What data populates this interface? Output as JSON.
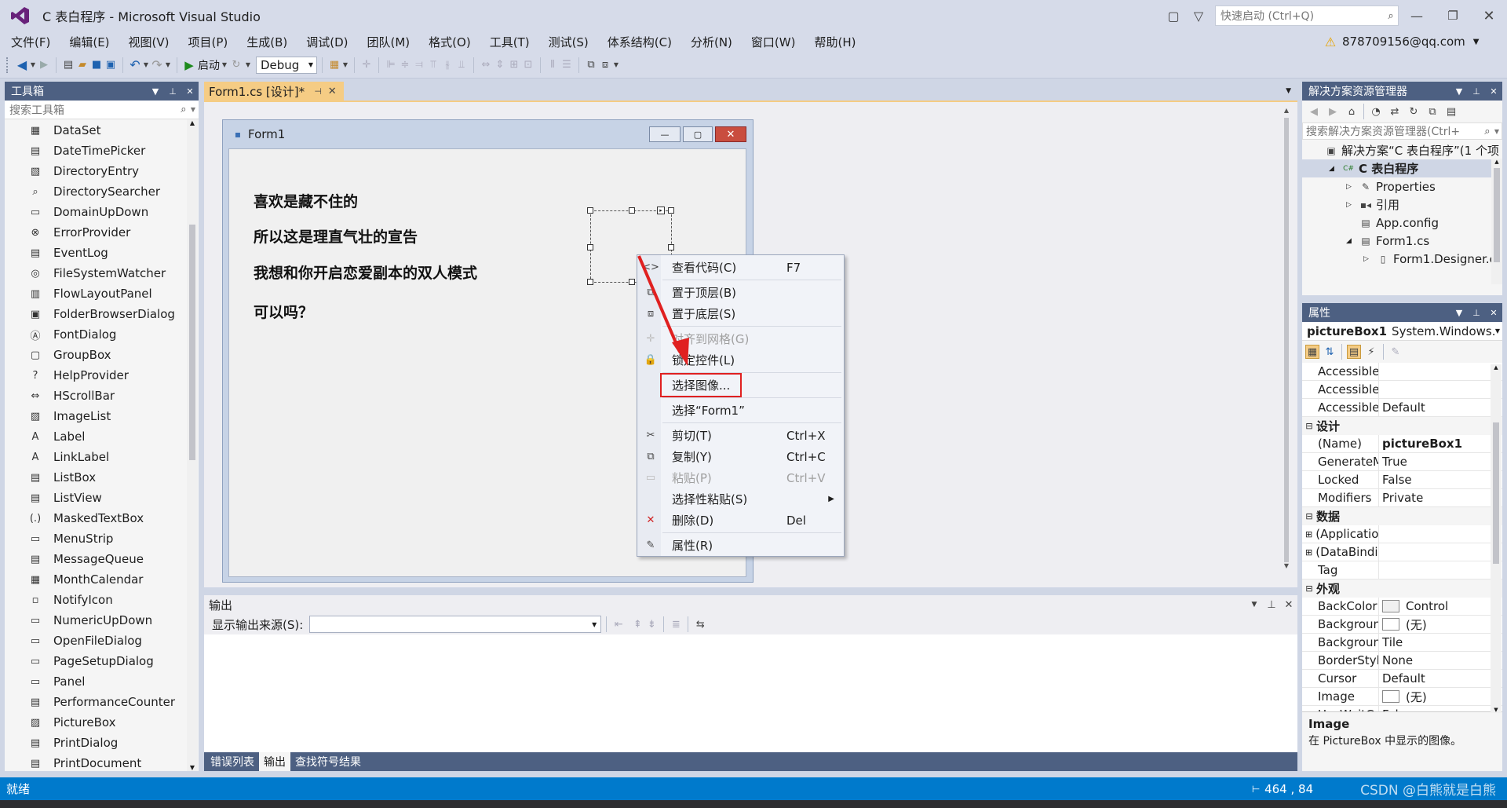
{
  "window": {
    "title": "C 表白程序 - Microsoft Visual Studio",
    "quick_launch_placeholder": "快速启动 (Ctrl+Q)",
    "account": "878709156@qq.com"
  },
  "menu": [
    "文件(F)",
    "编辑(E)",
    "视图(V)",
    "项目(P)",
    "生成(B)",
    "调试(D)",
    "团队(M)",
    "格式(O)",
    "工具(T)",
    "测试(S)",
    "体系结构(C)",
    "分析(N)",
    "窗口(W)",
    "帮助(H)"
  ],
  "toolbar": {
    "start_label": "启动",
    "config_value": "Debug"
  },
  "toolbox": {
    "title": "工具箱",
    "search_placeholder": "搜索工具箱",
    "items": [
      "DataSet",
      "DateTimePicker",
      "DirectoryEntry",
      "DirectorySearcher",
      "DomainUpDown",
      "ErrorProvider",
      "EventLog",
      "FileSystemWatcher",
      "FlowLayoutPanel",
      "FolderBrowserDialog",
      "FontDialog",
      "GroupBox",
      "HelpProvider",
      "HScrollBar",
      "ImageList",
      "Label",
      "LinkLabel",
      "ListBox",
      "ListView",
      "MaskedTextBox",
      "MenuStrip",
      "MessageQueue",
      "MonthCalendar",
      "NotifyIcon",
      "NumericUpDown",
      "OpenFileDialog",
      "PageSetupDialog",
      "Panel",
      "PerformanceCounter",
      "PictureBox",
      "PrintDialog",
      "PrintDocument"
    ]
  },
  "doc_tab": {
    "label": "Form1.cs [设计]*"
  },
  "form": {
    "title": "Form1",
    "lines": [
      "喜欢是藏不住的",
      "所以这是理直气壮的宣告",
      "我想和你开启恋爱副本的双人模式",
      "可以吗？"
    ]
  },
  "context_menu": {
    "items": [
      {
        "label": "查看代码(C)",
        "shortcut": "F7",
        "icon": "code-icon",
        "disabled": false
      },
      {
        "sep": true
      },
      {
        "label": "置于顶层(B)",
        "shortcut": "",
        "icon": "bring-to-front-icon",
        "disabled": false
      },
      {
        "label": "置于底层(S)",
        "shortcut": "",
        "icon": "send-to-back-icon",
        "disabled": false
      },
      {
        "sep": true
      },
      {
        "label": "对齐到网格(G)",
        "shortcut": "",
        "icon": "align-grid-icon",
        "disabled": true
      },
      {
        "label": "锁定控件(L)",
        "shortcut": "",
        "icon": "lock-icon",
        "disabled": false
      },
      {
        "sep": true
      },
      {
        "label": "选择图像...",
        "shortcut": "",
        "icon": "",
        "disabled": false,
        "highlighted": true
      },
      {
        "sep": true
      },
      {
        "label": "选择“Form1”",
        "shortcut": "",
        "icon": "",
        "disabled": false
      },
      {
        "sep": true
      },
      {
        "label": "剪切(T)",
        "shortcut": "Ctrl+X",
        "icon": "cut-icon",
        "disabled": false
      },
      {
        "label": "复制(Y)",
        "shortcut": "Ctrl+C",
        "icon": "copy-icon",
        "disabled": false
      },
      {
        "label": "粘贴(P)",
        "shortcut": "Ctrl+V",
        "icon": "paste-icon",
        "disabled": true
      },
      {
        "label": "选择性粘贴(S)",
        "shortcut": "",
        "icon": "",
        "disabled": false,
        "submenu": true
      },
      {
        "label": "删除(D)",
        "shortcut": "Del",
        "icon": "delete-icon",
        "disabled": false
      },
      {
        "sep": true
      },
      {
        "label": "属性(R)",
        "shortcut": "",
        "icon": "wrench-icon",
        "disabled": false
      }
    ]
  },
  "output": {
    "title": "输出",
    "source_label": "显示输出来源(S):"
  },
  "bottom_tabs": [
    "错误列表",
    "输出",
    "查找符号结果"
  ],
  "solution_explorer": {
    "title": "解决方案资源管理器",
    "search_placeholder": "搜索解决方案资源管理器(Ctrl+",
    "nodes": [
      {
        "label": "解决方案“C 表白程序”(1 个项",
        "level": 0,
        "arrow": "",
        "icon": "solution-icon",
        "bold": false
      },
      {
        "label": "C 表白程序",
        "level": 1,
        "arrow": "◢",
        "icon": "csharp-project-icon",
        "bold": true
      },
      {
        "label": "Properties",
        "level": 2,
        "arrow": "▷",
        "icon": "wrench-icon",
        "bold": false
      },
      {
        "label": "引用",
        "level": 2,
        "arrow": "▷",
        "icon": "references-icon",
        "bold": false
      },
      {
        "label": "App.config",
        "level": 2,
        "arrow": "",
        "icon": "config-file-icon",
        "bold": false
      },
      {
        "label": "Form1.cs",
        "level": 2,
        "arrow": "◢",
        "icon": "form-icon",
        "bold": false
      },
      {
        "label": "Form1.Designer.c",
        "level": 3,
        "arrow": "▷",
        "icon": "cs-file-icon",
        "bold": false
      }
    ]
  },
  "properties": {
    "title": "属性",
    "object_name": "pictureBox1",
    "object_type": "System.Windows.I",
    "rows": [
      {
        "k": "AccessibleDe",
        "v": ""
      },
      {
        "k": "AccessibleNa",
        "v": ""
      },
      {
        "k": "AccessibleRo",
        "v": "Default"
      },
      {
        "cat": "设计"
      },
      {
        "k": "(Name)",
        "v": "pictureBox1",
        "bold": true
      },
      {
        "k": "GenerateMer",
        "v": "True"
      },
      {
        "k": "Locked",
        "v": "False"
      },
      {
        "k": "Modifiers",
        "v": "Private"
      },
      {
        "cat": "数据"
      },
      {
        "k": "(ApplicationS",
        "v": "",
        "expand": true
      },
      {
        "k": "(DataBindings",
        "v": "",
        "expand": true
      },
      {
        "k": "Tag",
        "v": ""
      },
      {
        "cat": "外观"
      },
      {
        "k": "BackColor",
        "v": "Control",
        "swatch": "#f0f0f0"
      },
      {
        "k": "BackgroundIr",
        "v": "(无)",
        "swatch": "#ffffff"
      },
      {
        "k": "BackgroundIr",
        "v": "Tile"
      },
      {
        "k": "BorderStyle",
        "v": "None"
      },
      {
        "k": "Cursor",
        "v": "Default"
      },
      {
        "k": "Image",
        "v": "(无)",
        "swatch": "#ffffff"
      },
      {
        "k": "UseWaitCurs",
        "v": "False"
      }
    ],
    "desc_title": "Image",
    "desc_text": "在 PictureBox 中显示的图像。"
  },
  "status": {
    "left": "就绪",
    "position": "464 , 84",
    "watermark": "CSDN @白熊就是白熊"
  },
  "colors": {
    "accent_blue": "#007acc",
    "panel_header": "#4d6082",
    "highlight_red": "#e02020"
  }
}
